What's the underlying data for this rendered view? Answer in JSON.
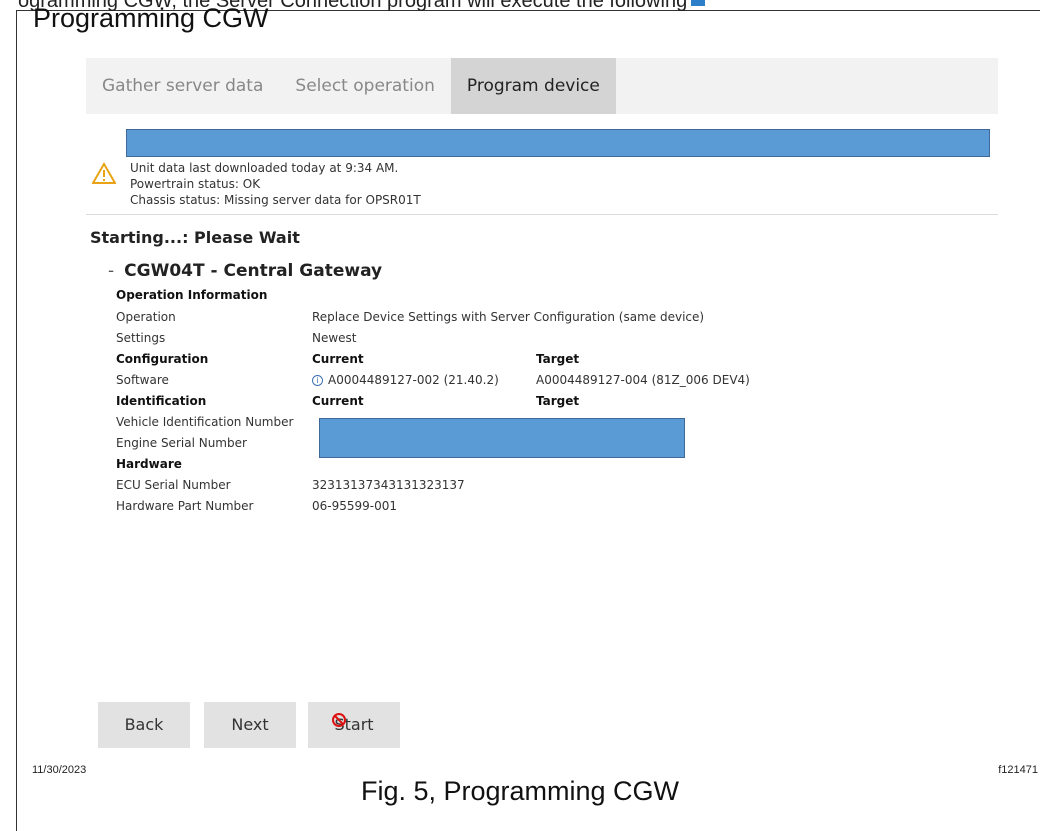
{
  "doc": {
    "top_partial": "ogramming CGW, the Server Connection program will execute the following",
    "title": "Programming CGW",
    "date": "11/30/2023",
    "figure_id": "f121471",
    "caption": "Fig. 5, Programming CGW"
  },
  "tabs": [
    {
      "label": "Gather server data",
      "active": false
    },
    {
      "label": "Select operation",
      "active": false
    },
    {
      "label": "Program device",
      "active": true
    }
  ],
  "status": {
    "line1": "Unit data last downloaded today at 9:34 AM.",
    "line2": "Powertrain status: OK",
    "line3": "Chassis status: Missing server data for OPSR01T"
  },
  "starting": "Starting...: Please Wait",
  "device": {
    "dash": "-",
    "title": "CGW04T - Central Gateway"
  },
  "details": {
    "operation_information": "Operation Information",
    "operation_label": "Operation",
    "operation_value": "Replace Device Settings with Server Configuration (same device)",
    "settings_label": "Settings",
    "settings_value": "Newest",
    "configuration": "Configuration",
    "current": "Current",
    "target": "Target",
    "software_label": "Software",
    "software_current": "A0004489127-002 (21.40.2)",
    "software_target": "A0004489127-004 (81Z_006 DEV4)",
    "identification": "Identification",
    "vin_label": "Vehicle Identification Number",
    "esn_label": "Engine Serial Number",
    "hardware": "Hardware",
    "ecu_label": "ECU Serial Number",
    "ecu_value": "32313137343131323137",
    "hwpn_label": "Hardware Part Number",
    "hwpn_value": "06-95599-001"
  },
  "buttons": {
    "back": "Back",
    "next": "Next",
    "start": "Start"
  },
  "colors": {
    "progress": "#5b9bd5",
    "warning": "#e8a317",
    "active_tab": "#d4d4d4"
  }
}
